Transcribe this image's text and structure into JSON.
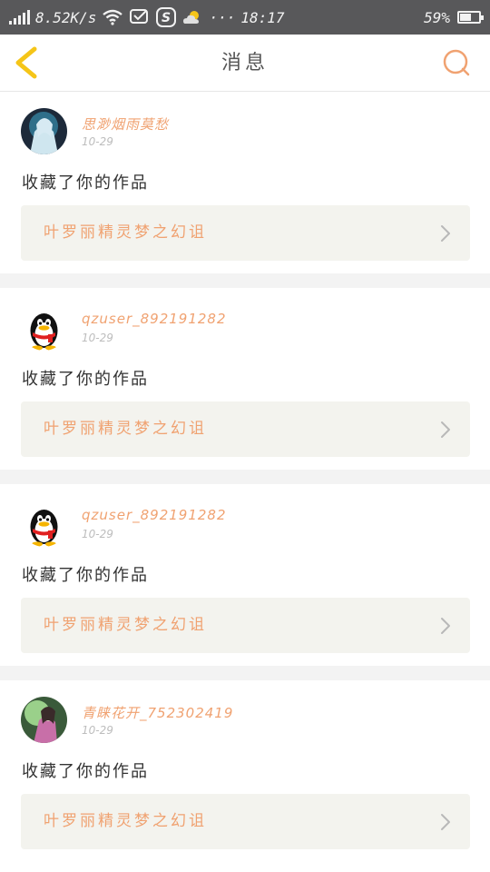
{
  "status_bar": {
    "network_speed": "8.52K/s",
    "time": "18:17",
    "battery": "59%",
    "battery_level": 0.59,
    "icons": [
      "signal-icon",
      "wifi-icon",
      "message-icon",
      "s-icon",
      "weather-icon",
      "more-icon"
    ],
    "more": "···"
  },
  "nav": {
    "title": "消息",
    "back_icon": "chevron-left-icon",
    "search_icon": "search-icon"
  },
  "colors": {
    "accent": "#f0a271",
    "back_icon": "#f5c518",
    "card_row_bg": "#f3f3ee",
    "divider_bg": "#f3f3f3"
  },
  "messages": [
    {
      "username": "思渺烟雨莫愁",
      "time": "10-29",
      "action": "收藏了你的作品",
      "work_title": "叶罗丽精灵梦之幻诅",
      "avatar": "anime-avatar"
    },
    {
      "username": "qzuser_892191282",
      "time": "10-29",
      "action": "收藏了你的作品",
      "work_title": "叶罗丽精灵梦之幻诅",
      "avatar": "penguin-avatar"
    },
    {
      "username": "qzuser_892191282",
      "time": "10-29",
      "action": "收藏了你的作品",
      "work_title": "叶罗丽精灵梦之幻诅",
      "avatar": "penguin-avatar"
    },
    {
      "username": "青睐花开_752302419",
      "time": "10-29",
      "action": "收藏了你的作品",
      "work_title": "叶罗丽精灵梦之幻诅",
      "avatar": "anime-avatar"
    }
  ]
}
